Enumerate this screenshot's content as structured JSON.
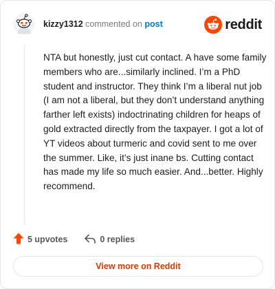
{
  "header": {
    "author": "kizzy1312",
    "commented_on": "commented on",
    "post_link": "post",
    "brand": "reddit"
  },
  "comment": {
    "body": "NTA but honestly, just cut contact. A have some family members who are...similarly inclined. I’m a PhD student and instructor. They think I’m a liberal nut job (I am not a liberal, but they don’t understand anything farther left exists) indoctrinating children for heaps of gold extracted directly from the taxpayer. I got a lot of YT videos about turmeric and covid sent to me over the summer. Like, it’s just inane bs. Cutting contact has made my life so much easier. And...better. Highly recommend."
  },
  "actions": {
    "upvotes": "5 upvotes",
    "replies": "0 replies"
  },
  "footer": {
    "view_more": "View more on Reddit"
  },
  "colors": {
    "brand_orange": "#ff4500",
    "link_blue": "#0079d3",
    "button_text": "#d93a00"
  },
  "icons": {
    "avatar": "snoo-avatar-icon",
    "brand": "reddit-logo-icon",
    "upvote": "upvote-arrow-icon",
    "reply": "reply-arrow-icon"
  }
}
